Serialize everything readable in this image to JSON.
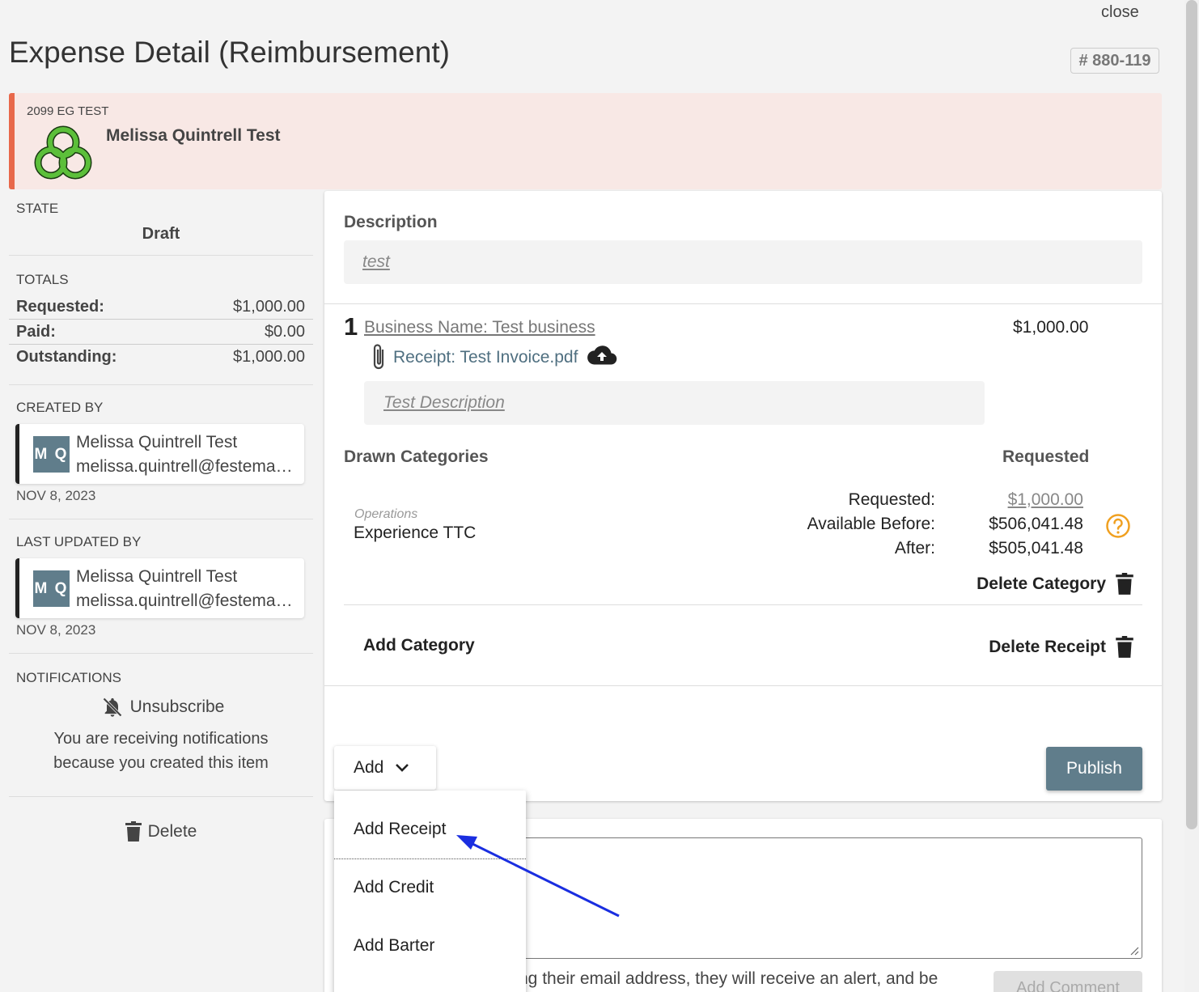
{
  "header": {
    "close_label": "close",
    "title": "Expense Detail (Reimbursement)",
    "id_badge": "# 880-119"
  },
  "org": {
    "code": "2099 EG TEST",
    "name": "Melissa Quintrell Test",
    "logo_icon": "interlocking-rings-logo"
  },
  "sidebar": {
    "state_label": "STATE",
    "state_value": "Draft",
    "totals_label": "TOTALS",
    "totals": [
      {
        "label": "Requested:",
        "value": "$1,000.00"
      },
      {
        "label": "Paid:",
        "value": "$0.00"
      },
      {
        "label": "Outstanding:",
        "value": "$1,000.00"
      }
    ],
    "created_by_label": "CREATED BY",
    "created_by": {
      "initials": "M Q",
      "name": "Melissa Quintrell Test",
      "email": "melissa.quintrell@festemail.com"
    },
    "created_date": "NOV 8, 2023",
    "last_updated_label": "LAST UPDATED BY",
    "last_updated_by": {
      "initials": "M Q",
      "name": "Melissa Quintrell Test",
      "email": "melissa.quintrell@festemail.com"
    },
    "updated_date": "NOV 8, 2023",
    "notifications_label": "NOTIFICATIONS",
    "unsubscribe_label": "Unsubscribe",
    "notification_text_1": "You are receiving notifications",
    "notification_text_2": "because you created this item",
    "delete_label": "Delete"
  },
  "main": {
    "description_label": "Description",
    "description_value": "test",
    "receipt": {
      "number": "1",
      "business_name": "Business Name: Test business",
      "amount": "$1,000.00",
      "file_label": "Receipt: Test Invoice.pdf",
      "description": "Test Description"
    },
    "drawn_categories_label": "Drawn Categories",
    "requested_header": "Requested",
    "category": {
      "group": "Operations",
      "name": "Experience TTC",
      "requested_label": "Requested:",
      "requested_value": "$1,000.00",
      "available_before_label": "Available Before:",
      "available_before_value": "$506,041.48",
      "after_label": "After:",
      "after_value": "$505,041.48"
    },
    "delete_category_label": "Delete Category",
    "add_category_label": "Add Category",
    "delete_receipt_label": "Delete Receipt",
    "add_button_label": "Add",
    "publish_label": "Publish"
  },
  "menu": {
    "items": [
      "Add Receipt",
      "Add Credit",
      "Add Barter"
    ]
  },
  "comments": {
    "hint_text": "ng their email address, they will receive an alert, and be",
    "add_comment_label": "Add Comment"
  },
  "colors": {
    "accent": "#607d8b",
    "banner_bg": "#f8e8e5",
    "banner_border": "#e8684a",
    "warning": "#f0a020",
    "annotation_arrow": "#1a2ee0"
  }
}
